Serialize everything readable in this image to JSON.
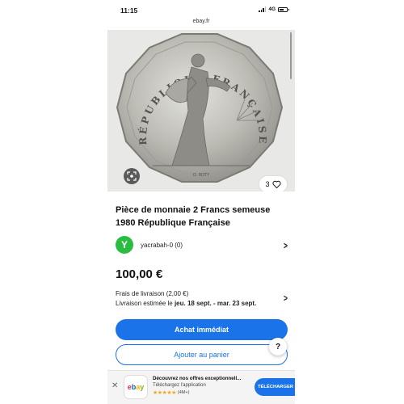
{
  "status_bar": {
    "time": "11:15",
    "network": "4G"
  },
  "browser": {
    "url": "ebay.fr"
  },
  "listing": {
    "image_like_count": "3",
    "title": "Pièce de monnaie 2 Francs semeuse 1980 République Française",
    "coin": {
      "legend": "RÉPUBLIQUE FRANÇAISE",
      "engraver": "O. ROTY"
    },
    "seller": {
      "avatar_letter": "Y",
      "name": "yacrabah-0 (0)"
    },
    "price": "100,00 €",
    "shipping": {
      "cost": "Frais de livraison (2,00 €)",
      "delivery_prefix": "Livraison estimée le",
      "delivery_dates": "jeu. 18 sept. - mar. 23 sept."
    },
    "buy_now_label": "Achat immédiat",
    "add_to_cart_label": "Ajouter au panier",
    "help_label": "?"
  },
  "app_banner": {
    "logo_text": "ebay",
    "title": "Découvrez nos offres exceptionnell...",
    "subtitle": "Téléchargez l'application",
    "stars": "★★★★★",
    "rating_count": "(4M+)",
    "cta_label": "TÉLÉCHARGER"
  },
  "colors": {
    "accent_blue": "#1a73e8",
    "avatar_green": "#2bbc42",
    "star_orange": "#f5a623",
    "ebay_red": "#e53238",
    "ebay_blue": "#0064d2",
    "ebay_yellow": "#f5af02",
    "ebay_green": "#86b817"
  },
  "icons": [
    "signal-icon",
    "battery-icon",
    "visual-search-icon",
    "heart-icon",
    "chevron-right-icon",
    "close-icon"
  ]
}
